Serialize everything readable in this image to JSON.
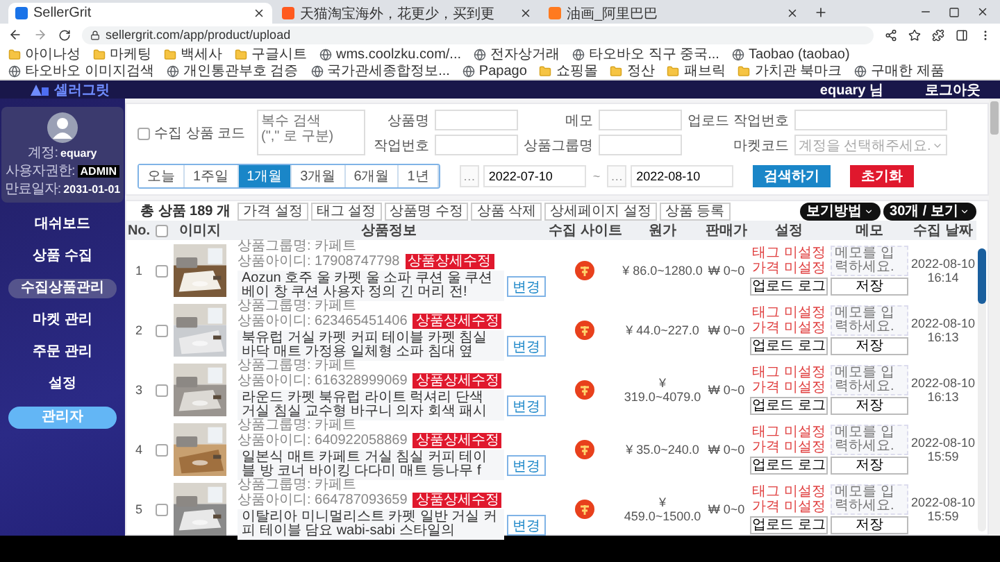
{
  "browser": {
    "tabs": [
      {
        "title": "SellerGrit",
        "selected": true
      },
      {
        "title": "天猫淘宝海外，花更少，买到更",
        "selected": false
      },
      {
        "title": "油画_阿里巴巴",
        "selected": false
      }
    ],
    "url": "sellergrit.com/app/product/upload",
    "bookmarks": [
      {
        "label": "아이나성",
        "kind": "folder"
      },
      {
        "label": "마케팅",
        "kind": "folder"
      },
      {
        "label": "백세사",
        "kind": "folder"
      },
      {
        "label": "구글시트",
        "kind": "folder"
      },
      {
        "label": "wms.coolzku.com/...",
        "kind": "site"
      },
      {
        "label": "전자상거래",
        "kind": "site"
      },
      {
        "label": "타오바오 직구 중국...",
        "kind": "site"
      },
      {
        "label": "Taobao (taobao)",
        "kind": "site"
      },
      {
        "label": "타오바오 이미지검색",
        "kind": "site"
      },
      {
        "label": "개인통관부호 검증",
        "kind": "site"
      },
      {
        "label": "국가관세종합정보...",
        "kind": "site"
      },
      {
        "label": "Papago",
        "kind": "site"
      },
      {
        "label": "쇼핑몰",
        "kind": "folder"
      },
      {
        "label": "정산",
        "kind": "folder"
      },
      {
        "label": "패브릭",
        "kind": "folder"
      },
      {
        "label": "가치관 북마크",
        "kind": "folder"
      },
      {
        "label": "구매한 제품",
        "kind": "site"
      }
    ]
  },
  "header": {
    "logo": "셀러그릿",
    "user": "equary 님",
    "logout": "로그아웃"
  },
  "sidebar": {
    "profile": {
      "account_label": "계정:",
      "account": "equary",
      "role_label": "사용자권한:",
      "role": "ADMIN",
      "expiry_label": "만료일자:",
      "expiry": "2031-01-01"
    },
    "items": [
      {
        "label": "대쉬보드",
        "kind": "link",
        "selected": false
      },
      {
        "label": "상품 수집",
        "kind": "link",
        "selected": false
      },
      {
        "label": "수집상품관리",
        "kind": "link",
        "selected": true
      },
      {
        "label": "마켓 관리",
        "kind": "link",
        "selected": false
      },
      {
        "label": "주문 관리",
        "kind": "link",
        "selected": false
      },
      {
        "label": "설정",
        "kind": "link",
        "selected": false
      },
      {
        "label": "관리자",
        "kind": "button",
        "selected": false
      }
    ]
  },
  "filter": {
    "code_checkbox": {
      "label": "수집 상품 코드",
      "checked": false
    },
    "code_search": {
      "placeholder": "복수 검색\n(\",\" 로 구분)"
    },
    "fields": [
      {
        "label": "상품명",
        "kind": "input"
      },
      {
        "label": "메모",
        "kind": "input"
      },
      {
        "label": "업로드 작업번호",
        "kind": "input"
      },
      {
        "label": "작업번호",
        "kind": "input"
      },
      {
        "label": "상품그룹명",
        "kind": "input"
      },
      {
        "label": "마켓코드",
        "kind": "select",
        "placeholder": "계정을 선택해주세요."
      }
    ],
    "periods": [
      {
        "label": "오늘",
        "selected": false
      },
      {
        "label": "1주일",
        "selected": false
      },
      {
        "label": "1개월",
        "selected": true
      },
      {
        "label": "3개월",
        "selected": false
      },
      {
        "label": "6개월",
        "selected": false
      },
      {
        "label": "1년",
        "selected": false
      }
    ],
    "date_from": {
      "button": "…",
      "value": "2022-07-10"
    },
    "separator": "~",
    "date_to": {
      "button": "…",
      "value": "2022-08-10"
    },
    "search_button": "검색하기",
    "reset_button": "초기화"
  },
  "table": {
    "total": "총 상품 189 개",
    "actions": [
      "가격 설정",
      "태그 설정",
      "상품명 수정",
      "상품 삭제",
      "상세페이지 설정",
      "상품 등록"
    ],
    "view_buttons": [
      "보기방법",
      "30개 / 보기"
    ],
    "columns": [
      {
        "kind": "text",
        "label": "No."
      },
      {
        "kind": "checkbox",
        "checked": false
      },
      {
        "kind": "text",
        "label": "이미지"
      },
      {
        "kind": "text",
        "label": "상품정보"
      },
      {
        "kind": "text",
        "label": "수집 사이트"
      },
      {
        "kind": "text",
        "label": "원가"
      },
      {
        "kind": "text",
        "label": "판매가"
      },
      {
        "kind": "text",
        "label": "설정"
      },
      {
        "kind": "text",
        "label": "메모"
      },
      {
        "kind": "text",
        "label": "수집 날짜"
      }
    ],
    "rows": [
      {
        "no": "1",
        "checked": false,
        "group": "상품그룹명: 카페트",
        "product_id": "상품아이디: 17908747798",
        "badge": "상품상세수정",
        "title": "Aozun 호주 울 카펫 울 소파 쿠션 울 쿠션 베이 창 쿠션 사용자 정의 긴 머리 전!",
        "change_button": "변경",
        "cost": "¥ 86.0~1280.0",
        "price": "₩ 0~0",
        "tag_status": "태그 미설정",
        "price_status": "가격 미설정",
        "log_button": "업로드 로그",
        "memo_placeholder": "메모를 입력하세요.",
        "save_button": "저장",
        "date": "2022-08-10 16:14"
      },
      {
        "no": "2",
        "checked": false,
        "group": "상품그룹명: 카페트",
        "product_id": "상품아이디: 623465451406",
        "badge": "상품상세수정",
        "title": "북유럽 거실 카펫 커피 테이블 카펫 침실 바닥 매트 가정용 일체형 소파 침대 옆",
        "change_button": "변경",
        "cost": "¥ 44.0~227.0",
        "price": "₩ 0~0",
        "tag_status": "태그 미설정",
        "price_status": "가격 미설정",
        "log_button": "업로드 로그",
        "memo_placeholder": "메모를 입력하세요.",
        "save_button": "저장",
        "date": "2022-08-10 16:13"
      },
      {
        "no": "3",
        "checked": false,
        "group": "상품그룹명: 카페트",
        "product_id": "상품아이디: 616328999069",
        "badge": "상품상세수정",
        "title": "라운드 카펫 북유럽 라이트 럭셔리 단색 거실 침실 교수형 바구니 의자 회색 패시",
        "change_button": "변경",
        "cost": "¥ 319.0~4079.0",
        "price": "₩ 0~0",
        "tag_status": "태그 미설정",
        "price_status": "가격 미설정",
        "log_button": "업로드 로그",
        "memo_placeholder": "메모를 입력하세요.",
        "save_button": "저장",
        "date": "2022-08-10 16:13"
      },
      {
        "no": "4",
        "checked": false,
        "group": "상품그룹명: 카페트",
        "product_id": "상품아이디: 640922058869",
        "badge": "상품상세수정",
        "title": "일본식 매트 카페트 거실 침실 커피 테이블 방 코너 바이킹 다다미 매트 등나무 f",
        "change_button": "변경",
        "cost": "¥ 35.0~240.0",
        "price": "₩ 0~0",
        "tag_status": "태그 미설정",
        "price_status": "가격 미설정",
        "log_button": "업로드 로그",
        "memo_placeholder": "메모를 입력하세요.",
        "save_button": "저장",
        "date": "2022-08-10 15:59"
      },
      {
        "no": "5",
        "checked": false,
        "group": "상품그룹명: 카페트",
        "product_id": "상품아이디: 664787093659",
        "badge": "상품상세수정",
        "title": "이탈리아 미니멀리스트 카펫 일반 거실 커피 테이블 담요 wabi-sabi 스타일의",
        "change_button": "변경",
        "cost": "¥ 459.0~1500.0",
        "price": "₩ 0~0",
        "tag_status": "태그 미설정",
        "price_status": "가격 미설정",
        "log_button": "업로드 로그",
        "memo_placeholder": "메모를 입력하세요.",
        "save_button": "저장",
        "date": "2022-08-10 15:59"
      }
    ]
  }
}
